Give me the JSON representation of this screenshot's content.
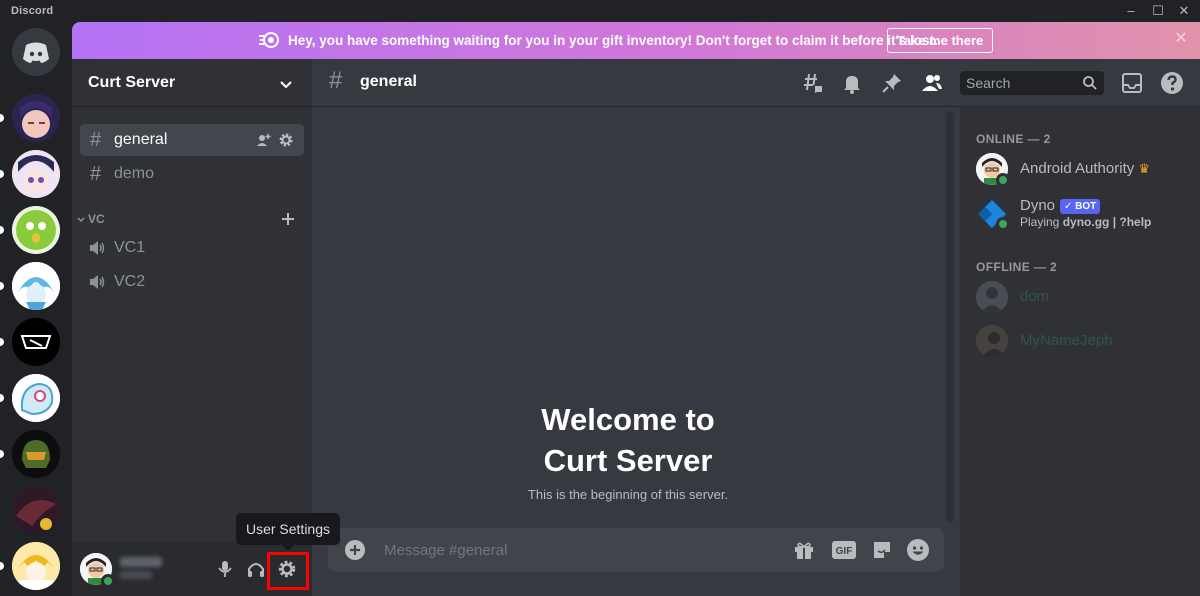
{
  "window": {
    "app_name": "Discord",
    "controls": [
      "–",
      "☐",
      "✕"
    ]
  },
  "banner": {
    "text": "Hey, you have something waiting for you in your gift inventory! Don't forget to claim it before it's lost.",
    "button": "Take me there",
    "close": "✕",
    "colors": [
      "#b473f5",
      "#e292aa"
    ]
  },
  "server": {
    "name": "Curt Server"
  },
  "channels": {
    "text": [
      {
        "name": "general",
        "active": true
      },
      {
        "name": "demo",
        "active": false
      }
    ],
    "category": "VC",
    "voice": [
      {
        "name": "VC1"
      },
      {
        "name": "VC2"
      }
    ]
  },
  "header": {
    "channel": "general",
    "search_placeholder": "Search"
  },
  "welcome": {
    "line1": "Welcome to",
    "line2": "Curt Server",
    "subtitle": "This is the beginning of this server."
  },
  "composer": {
    "placeholder": "Message #general",
    "gif_label": "GIF"
  },
  "tooltip": "User Settings",
  "members": {
    "online_header": "ONLINE — 2",
    "offline_header": "OFFLINE — 2",
    "online": [
      {
        "name": "Android Authority",
        "crown": "♛"
      },
      {
        "name": "Dyno",
        "tag": "✓ BOT",
        "activity_prefix": "Playing ",
        "activity": "dyno.gg | ?help"
      }
    ],
    "offline": [
      {
        "name": "dom"
      },
      {
        "name": "MyNameJeph"
      }
    ]
  },
  "colors": {
    "accent": "#5865f2",
    "online": "#3ba55d",
    "offline_name": "#2d6a4f",
    "highlight": "#ff0000"
  }
}
